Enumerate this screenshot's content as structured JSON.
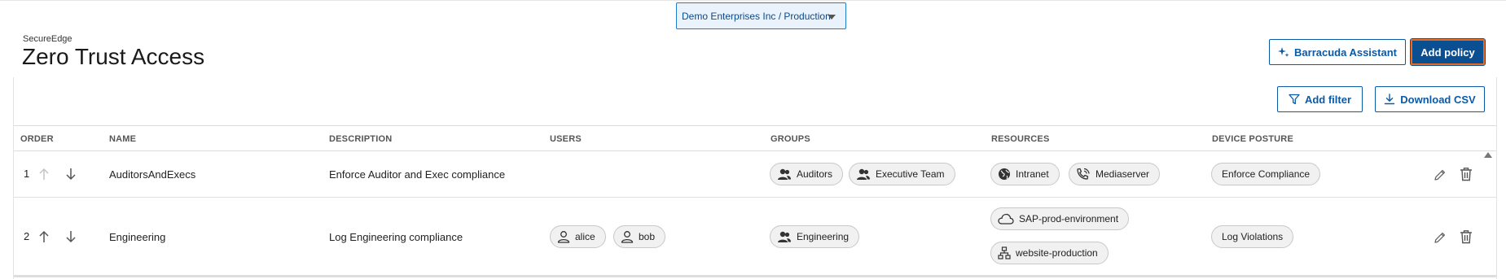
{
  "tenant_selector": {
    "label": "Demo Enterprises Inc / Production"
  },
  "header": {
    "brand": "SecureEdge",
    "title": "Zero Trust Access"
  },
  "actions": {
    "assistant_label": "Barracuda Assistant",
    "add_policy_label": "Add policy",
    "add_filter_label": "Add filter",
    "download_csv_label": "Download CSV"
  },
  "table": {
    "columns": [
      "ORDER",
      "NAME",
      "DESCRIPTION",
      "USERS",
      "GROUPS",
      "RESOURCES",
      "DEVICE POSTURE"
    ],
    "rows": [
      {
        "order": "1",
        "name": "AuditorsAndExecs",
        "description": "Enforce Auditor and Exec compliance",
        "users": [],
        "groups": [
          "Auditors",
          "Executive Team"
        ],
        "resources": [
          {
            "label": "Intranet",
            "icon": "globe-icon"
          },
          {
            "label": "Mediaserver",
            "icon": "phone-wifi-icon"
          }
        ],
        "device_posture": "Enforce Compliance"
      },
      {
        "order": "2",
        "name": "Engineering",
        "description": "Log Engineering compliance",
        "users": [
          "alice",
          "bob"
        ],
        "groups": [
          "Engineering"
        ],
        "resources": [
          {
            "label": "SAP-prod-environment",
            "icon": "cloud-icon"
          },
          {
            "label": "website-production",
            "icon": "network-icon"
          }
        ],
        "device_posture": "Log Violations"
      }
    ]
  },
  "colors": {
    "primary": "#0b4f93",
    "focus_outline": "#e86b1f",
    "chip_bg": "#f1f1f1"
  }
}
